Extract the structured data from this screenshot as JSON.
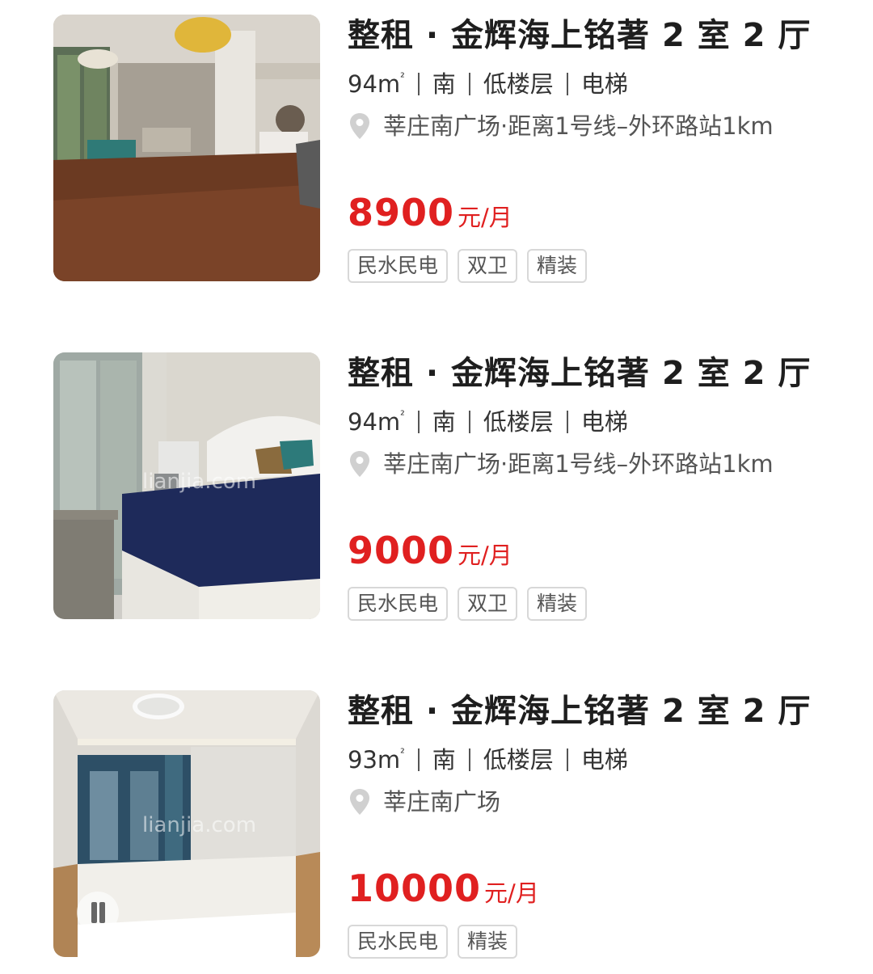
{
  "listings": [
    {
      "title": "整租 · 金辉海上铭著 2 室 2 厅",
      "area": "94m",
      "area_sup": "²",
      "orientation": "南",
      "floor": "低楼层",
      "elevator": "电梯",
      "location": "莘庄南广场·距离1号线–外环路站1km",
      "price": "8900",
      "price_unit": "元/月",
      "tags": [
        "民水民电",
        "双卫",
        "精装"
      ]
    },
    {
      "title": "整租 · 金辉海上铭著 2 室 2 厅",
      "area": "94m",
      "area_sup": "²",
      "orientation": "南",
      "floor": "低楼层",
      "elevator": "电梯",
      "location": "莘庄南广场·距离1号线–外环路站1km",
      "price": "9000",
      "price_unit": "元/月",
      "tags": [
        "民水民电",
        "双卫",
        "精装"
      ]
    },
    {
      "title": "整租 · 金辉海上铭著 2 室 2 厅",
      "area": "93m",
      "area_sup": "²",
      "orientation": "南",
      "floor": "低楼层",
      "elevator": "电梯",
      "location": "莘庄南广场",
      "price": "10000",
      "price_unit": "元/月",
      "tags": [
        "民水民电",
        "精装"
      ]
    }
  ],
  "watermark": "lianjia.com",
  "colors": {
    "price": "#e02020",
    "tag_border": "#d8d8d8"
  },
  "icons": {
    "location": "location-pin-icon",
    "video": "video-play-icon"
  }
}
